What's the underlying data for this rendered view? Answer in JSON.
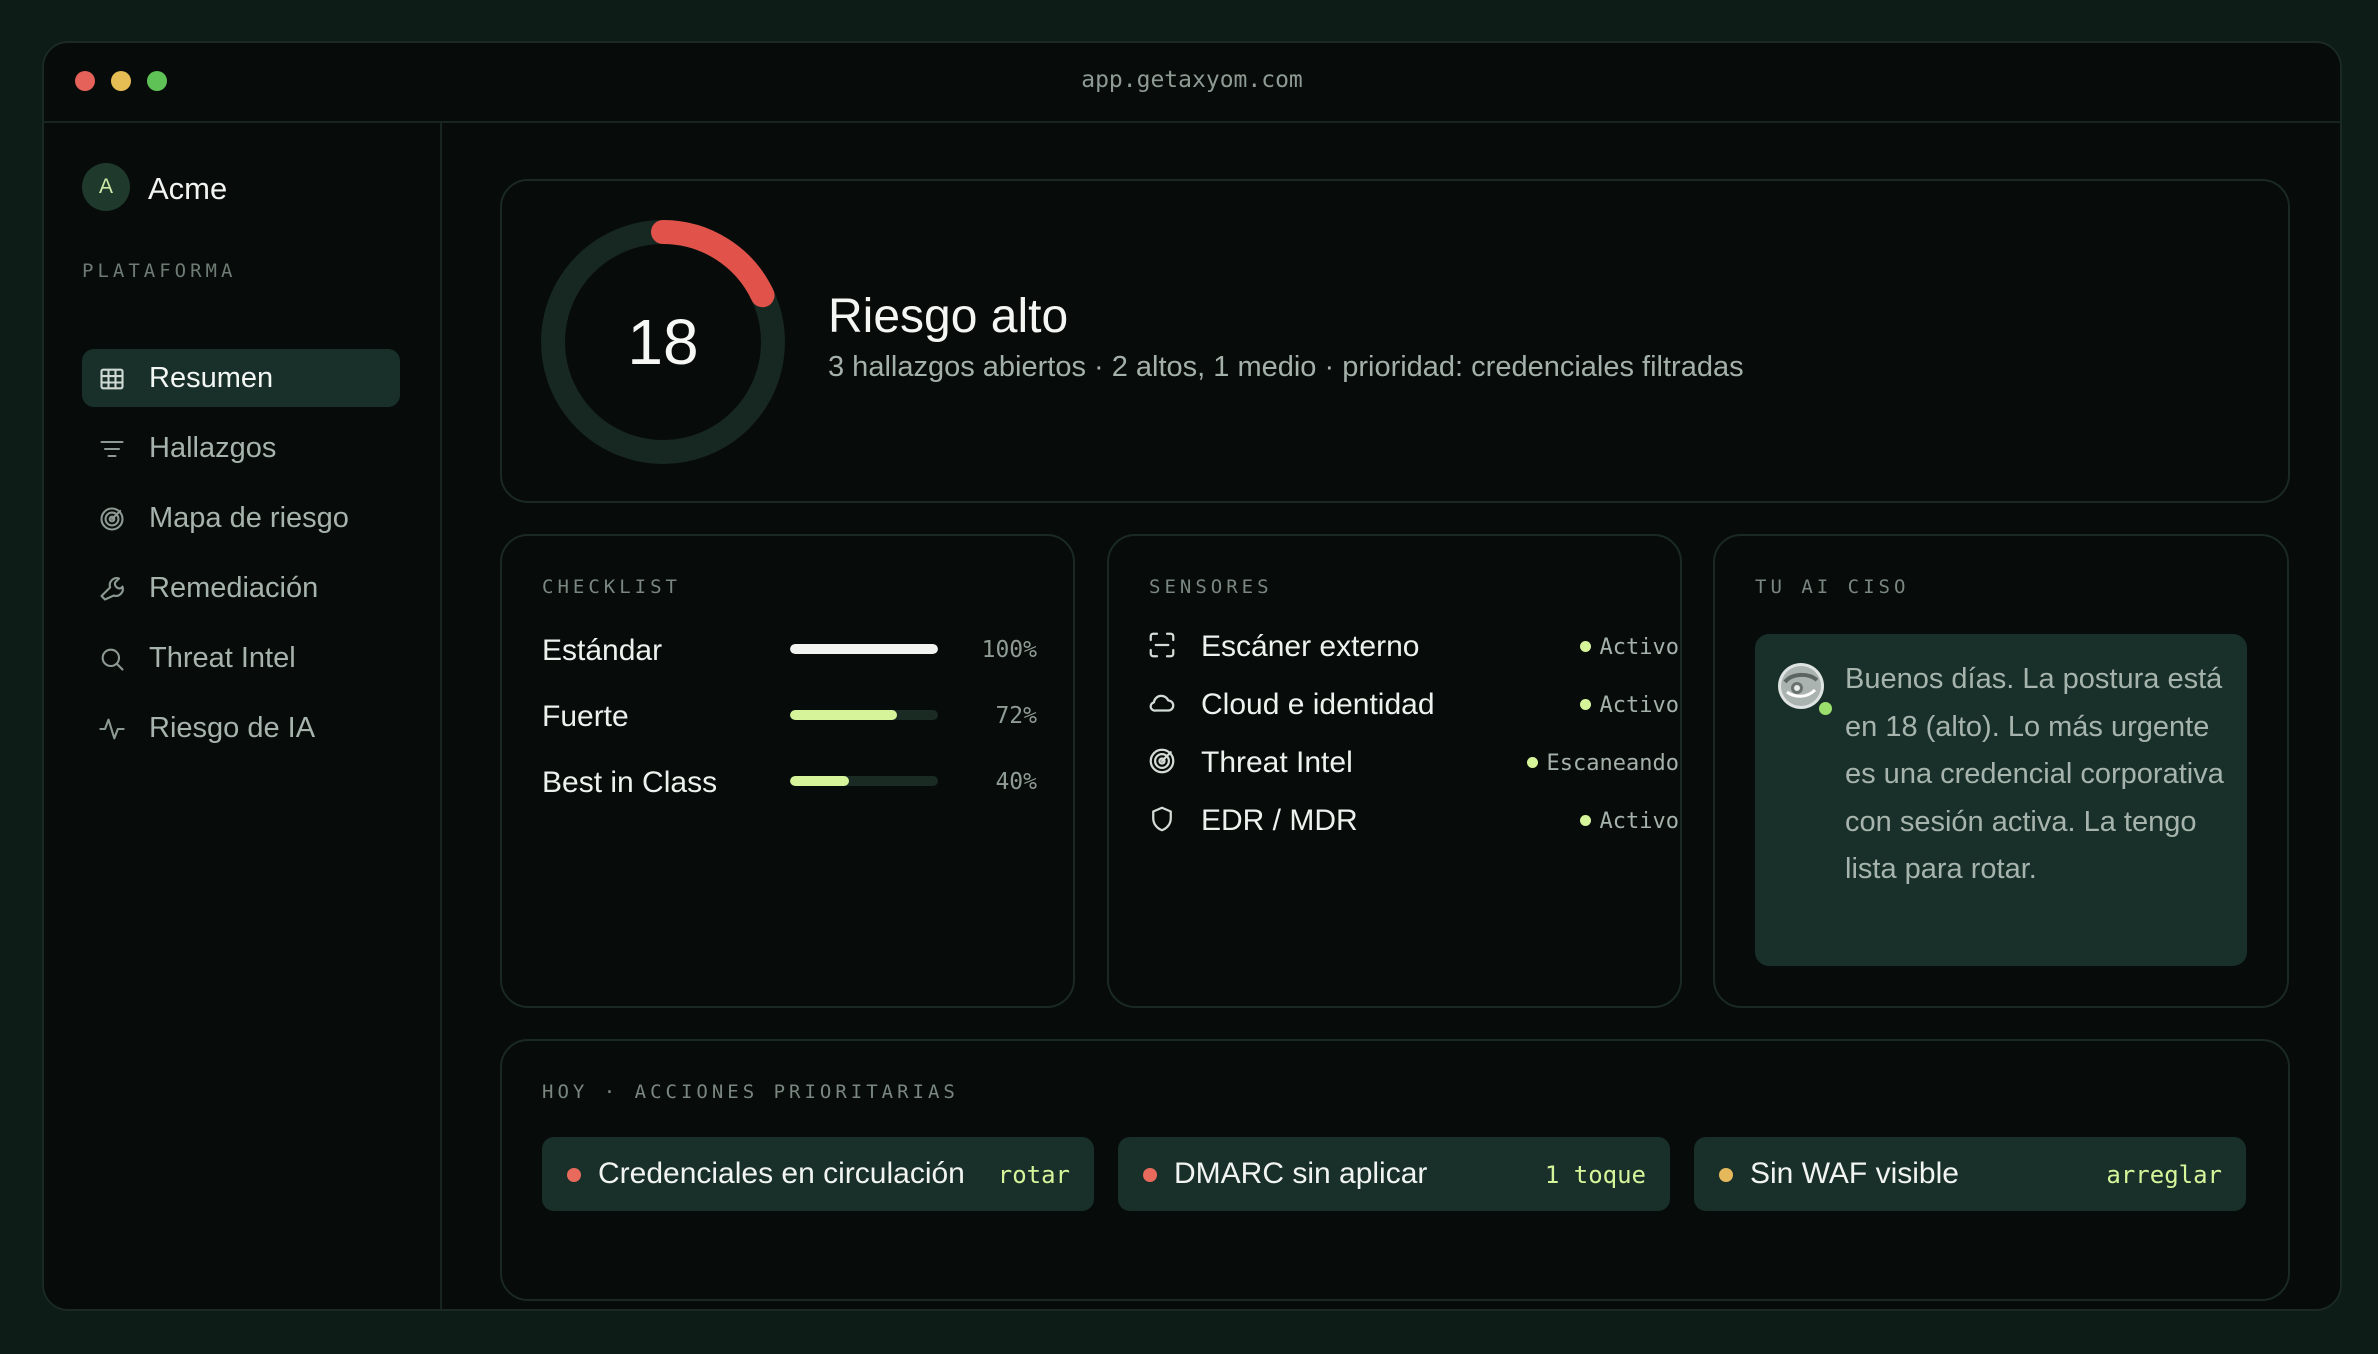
{
  "window": {
    "url": "app.getaxyom.com"
  },
  "sidebar": {
    "org_initial": "A",
    "org_name": "Acme",
    "section_label": "PLATAFORMA",
    "items": [
      {
        "label": "Resumen",
        "icon": "table-icon",
        "active": true
      },
      {
        "label": "Hallazgos",
        "icon": "filter-icon",
        "active": false
      },
      {
        "label": "Mapa de riesgo",
        "icon": "radar-icon",
        "active": false
      },
      {
        "label": "Remediación",
        "icon": "wrench-icon",
        "active": false
      },
      {
        "label": "Threat Intel",
        "icon": "search-icon",
        "active": false
      },
      {
        "label": "Riesgo de IA",
        "icon": "activity-icon",
        "active": false
      }
    ]
  },
  "risk": {
    "score": "18",
    "gauge_fraction": 0.18,
    "title": "Riesgo alto",
    "subtitle": "3 hallazgos abiertos · 2 altos, 1 medio · prioridad: credenciales filtradas"
  },
  "checklist": {
    "label": "CHECKLIST",
    "rows": [
      {
        "name": "Estándar",
        "pct": "100%",
        "value": 1.0,
        "color": "#f2f4f1"
      },
      {
        "name": "Fuerte",
        "pct": "72%",
        "value": 0.72,
        "color": "#d6f59a"
      },
      {
        "name": "Best in Class",
        "pct": "40%",
        "value": 0.4,
        "color": "#d6f59a"
      }
    ]
  },
  "sensors": {
    "label": "SENSORES",
    "rows": [
      {
        "name": "Escáner externo",
        "status": "Activo",
        "icon": "scan-icon"
      },
      {
        "name": "Cloud e identidad",
        "status": "Activo",
        "icon": "cloud-icon"
      },
      {
        "name": "Threat Intel",
        "status": "Escaneando",
        "icon": "radar-icon"
      },
      {
        "name": "EDR / MDR",
        "status": "Activo",
        "icon": "shield-icon"
      }
    ]
  },
  "ai_ciso": {
    "label": "TU AI CISO",
    "message": "Buenos días. La postura está en 18 (alto). Lo más urgente es una credencial corporativa con sesión activa. La tengo lista para rotar."
  },
  "actions": {
    "label": "HOY · ACCIONES PRIORITARIAS",
    "items": [
      {
        "label": "Credenciales en circulación",
        "action": "rotar",
        "dot_color": "#e86a5c"
      },
      {
        "label": "DMARC sin aplicar",
        "action": "1 toque",
        "dot_color": "#e86a5c"
      },
      {
        "label": "Sin WAF visible",
        "action": "arreglar",
        "dot_color": "#e6b85c"
      }
    ]
  },
  "colors": {
    "accent": "#d6f59a",
    "danger": "#e0524a",
    "background": "#070b09"
  }
}
